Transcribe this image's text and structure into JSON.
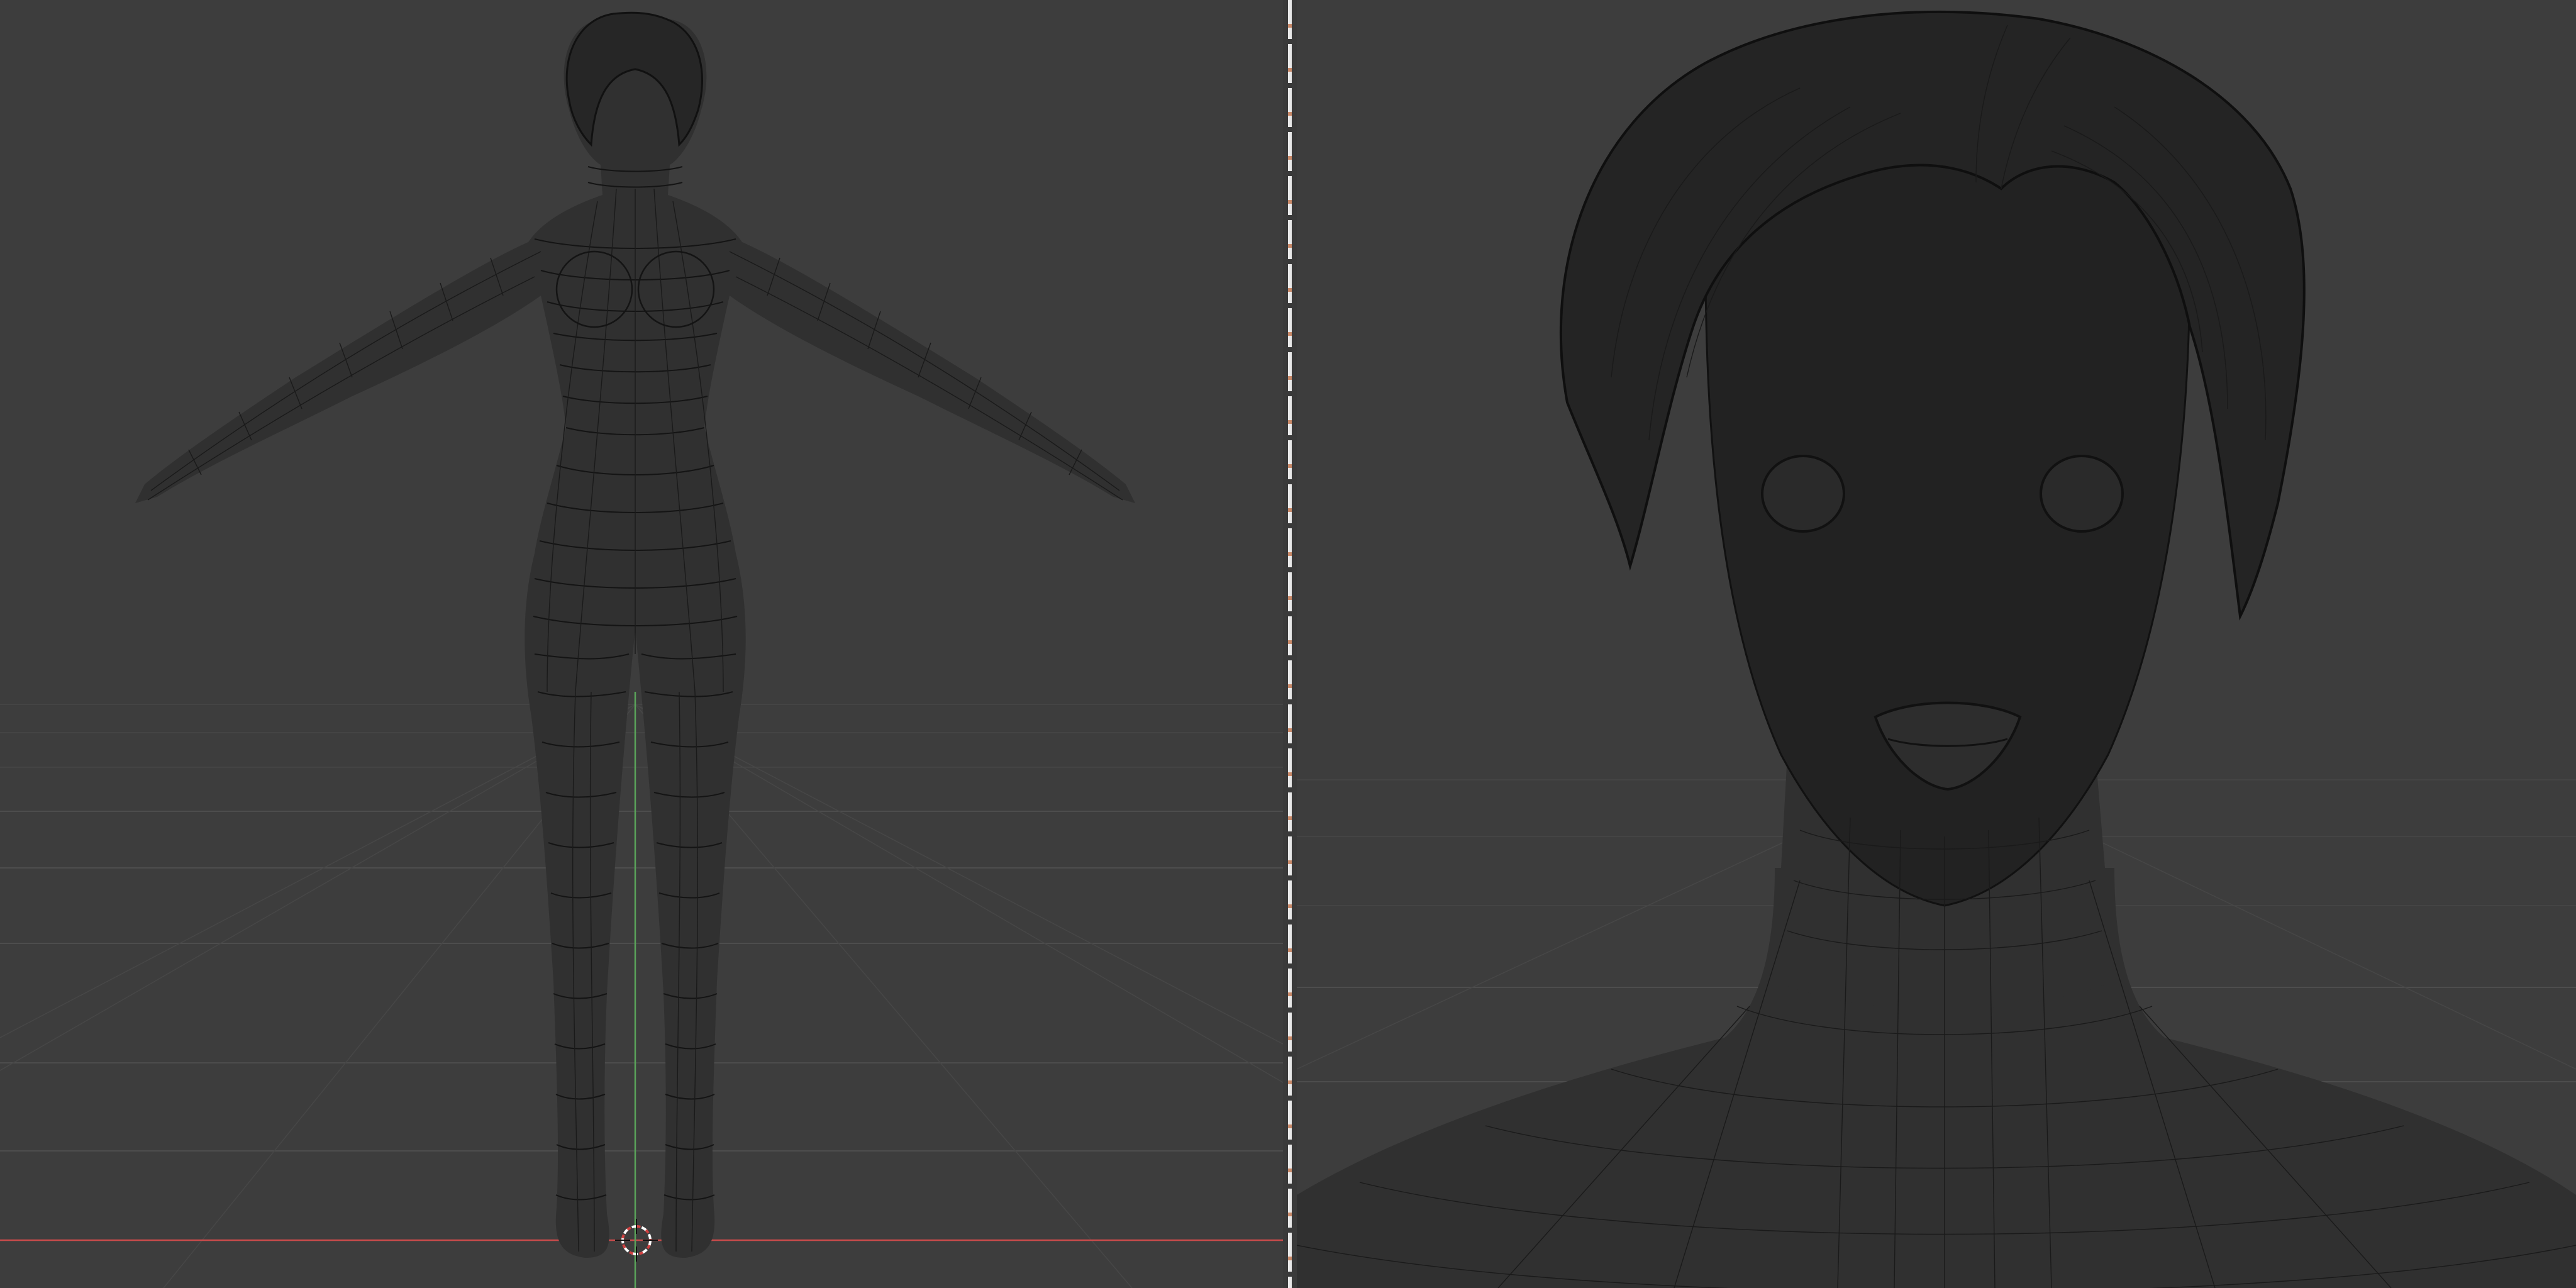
{
  "app": {
    "kind": "3d-viewport-split",
    "background_color": "#3d3d3d",
    "grid_color": "#4d4d4d",
    "x_axis_color": "#c94b4b",
    "y_axis_color": "#5aa35a",
    "wire_color": "#141414",
    "cursor_color": "#ffffff"
  },
  "left_viewport": {
    "view": "full-body-front",
    "shading": "wireframe-over-solid",
    "object": "character-mesh"
  },
  "right_viewport": {
    "view": "head-closeup-front",
    "shading": "wireframe-over-solid",
    "object": "character-mesh"
  },
  "icons": {
    "cursor": "3d-cursor-icon"
  }
}
